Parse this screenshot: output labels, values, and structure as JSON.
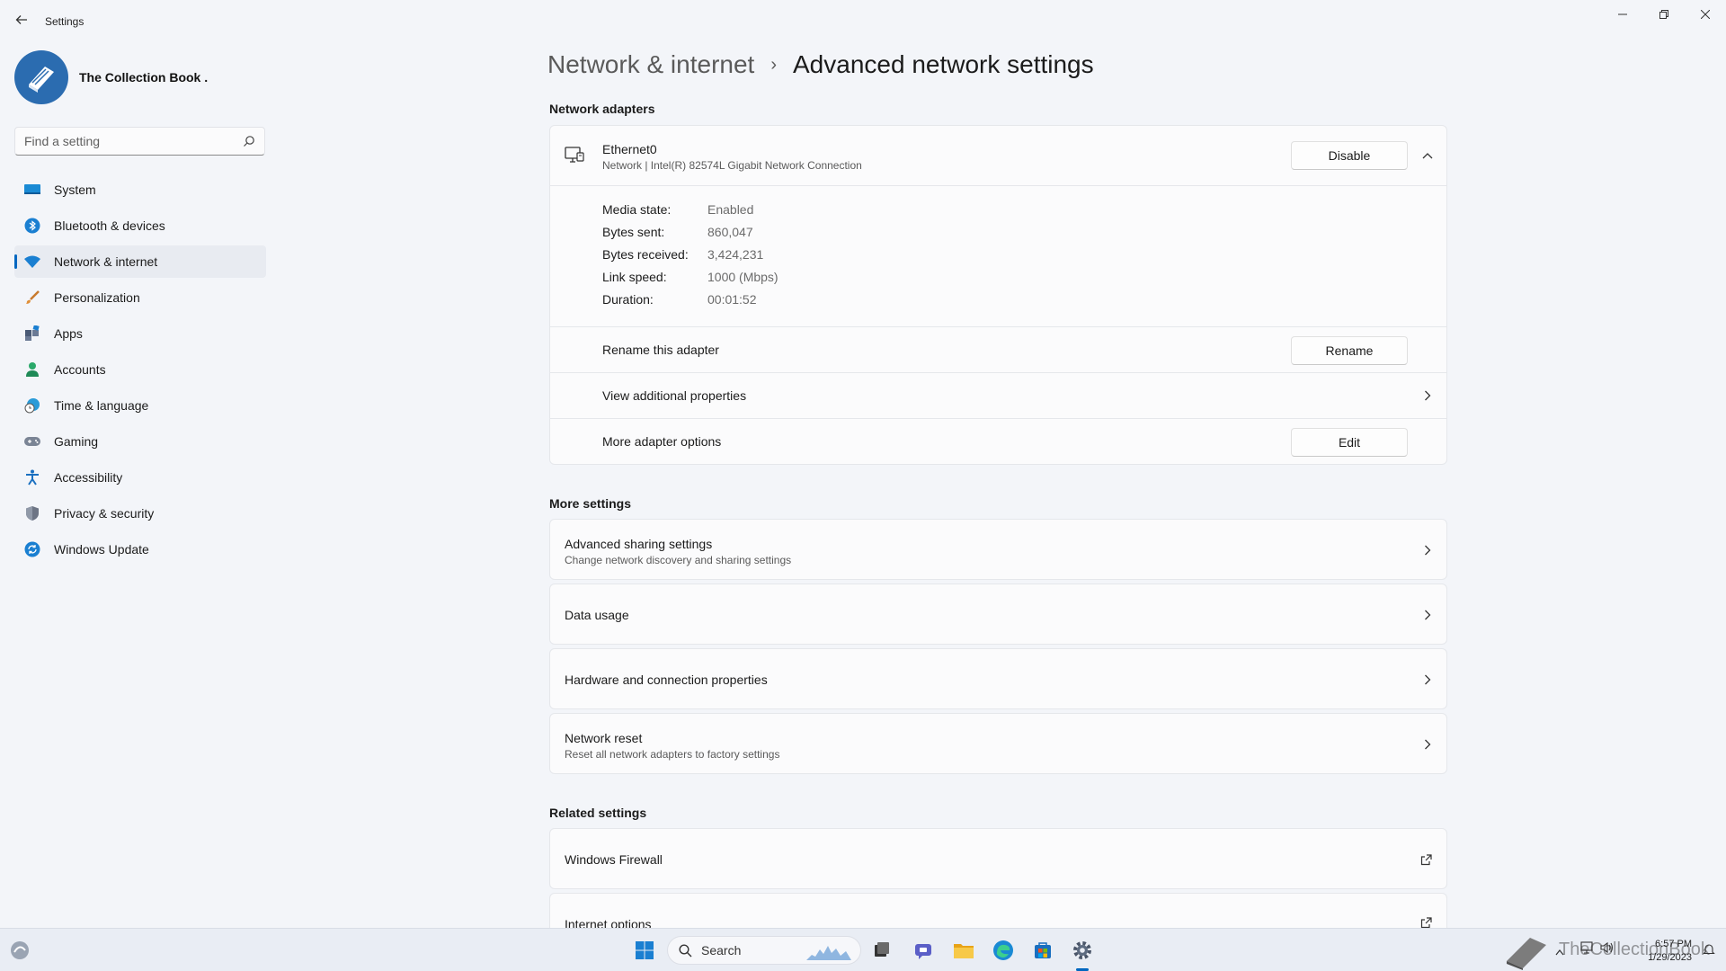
{
  "window": {
    "app_title": "Settings"
  },
  "profile": {
    "name": "The Collection Book ."
  },
  "search": {
    "placeholder": "Find a setting"
  },
  "sidebar": {
    "items": [
      {
        "label": "System",
        "icon": "system-icon"
      },
      {
        "label": "Bluetooth & devices",
        "icon": "bluetooth-icon"
      },
      {
        "label": "Network & internet",
        "icon": "wifi-icon",
        "active": true
      },
      {
        "label": "Personalization",
        "icon": "brush-icon"
      },
      {
        "label": "Apps",
        "icon": "apps-icon"
      },
      {
        "label": "Accounts",
        "icon": "person-icon"
      },
      {
        "label": "Time & language",
        "icon": "clock-globe-icon"
      },
      {
        "label": "Gaming",
        "icon": "gamepad-icon"
      },
      {
        "label": "Accessibility",
        "icon": "accessibility-icon"
      },
      {
        "label": "Privacy & security",
        "icon": "shield-icon"
      },
      {
        "label": "Windows Update",
        "icon": "update-icon"
      }
    ]
  },
  "breadcrumb": {
    "parent": "Network & internet",
    "separator": "›",
    "current": "Advanced network settings"
  },
  "adapters": {
    "section_title": "Network adapters",
    "adapter": {
      "name": "Ethernet0",
      "description": "Network | Intel(R) 82574L Gigabit Network Connection",
      "disable_label": "Disable",
      "stats": [
        {
          "label": "Media state:",
          "value": "Enabled"
        },
        {
          "label": "Bytes sent:",
          "value": "860,047"
        },
        {
          "label": "Bytes received:",
          "value": "3,424,231"
        },
        {
          "label": "Link speed:",
          "value": "1000 (Mbps)"
        },
        {
          "label": "Duration:",
          "value": "00:01:52"
        }
      ],
      "rename_label": "Rename this adapter",
      "rename_button": "Rename",
      "view_props_label": "View additional properties",
      "more_options_label": "More adapter options",
      "edit_button": "Edit"
    }
  },
  "more_settings": {
    "section_title": "More settings",
    "items": [
      {
        "title": "Advanced sharing settings",
        "subtitle": "Change network discovery and sharing settings"
      },
      {
        "title": "Data usage",
        "subtitle": ""
      },
      {
        "title": "Hardware and connection properties",
        "subtitle": ""
      },
      {
        "title": "Network reset",
        "subtitle": "Reset all network adapters to factory settings"
      }
    ]
  },
  "related_settings": {
    "section_title": "Related settings",
    "items": [
      {
        "title": "Windows Firewall"
      },
      {
        "title": "Internet options"
      }
    ]
  },
  "taskbar": {
    "search_label": "Search",
    "time": "6:57 PM",
    "date": "1/29/2023",
    "watermark": "TheCollectionBook"
  },
  "colors": {
    "accent": "#0067c0",
    "background": "#f3f5f9",
    "card": "#fbfbfc"
  }
}
